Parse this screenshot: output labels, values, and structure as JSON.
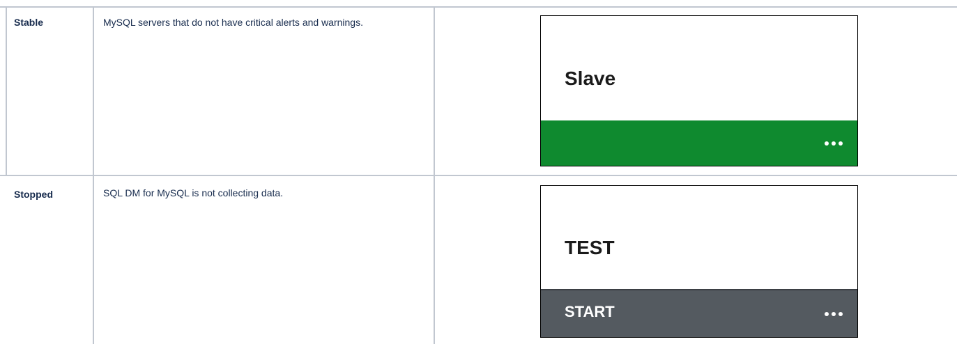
{
  "rows": [
    {
      "status": "Stable",
      "description": "MySQL servers that do not have critical alerts and warnings.",
      "card": {
        "title": "Slave",
        "bar_label": "",
        "bar_color": "#0f8a2f"
      }
    },
    {
      "status": "Stopped",
      "description": "SQL DM for MySQL is not collecting data.",
      "card": {
        "title": "TEST",
        "bar_label": "START",
        "bar_color": "#545a60"
      }
    }
  ]
}
